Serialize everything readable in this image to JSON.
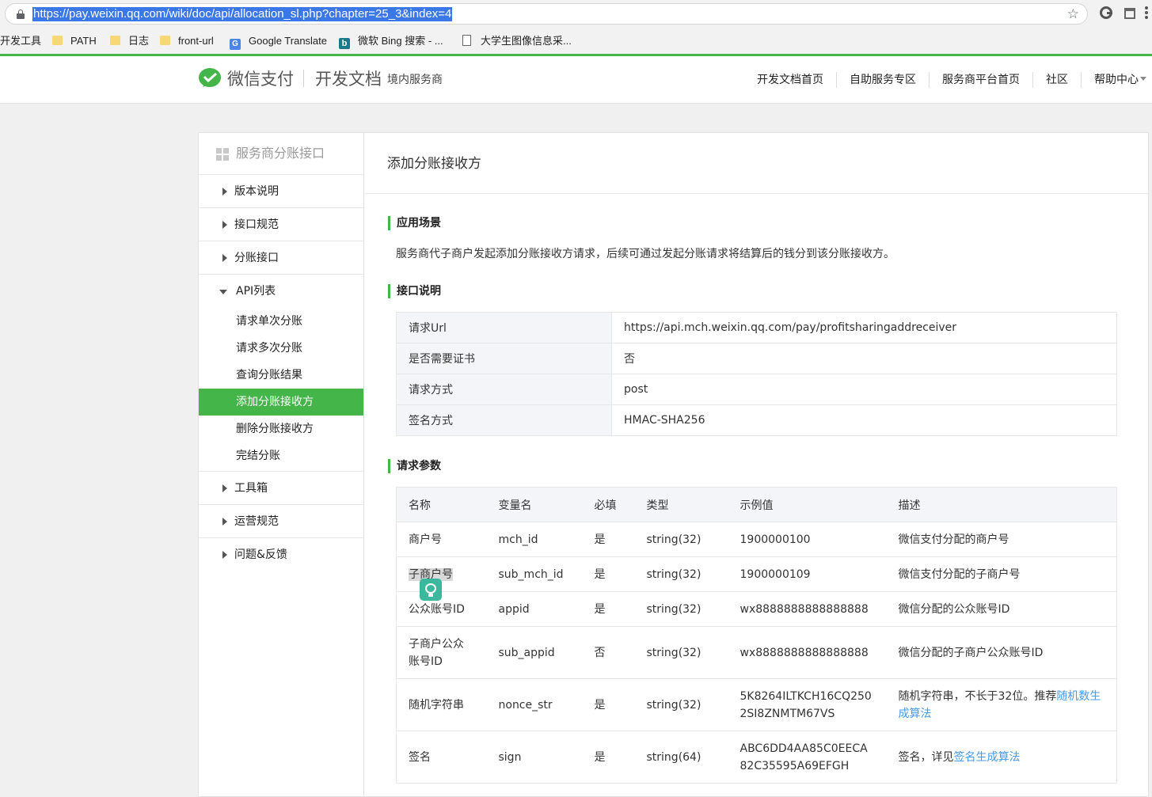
{
  "browser": {
    "url": "https://pay.weixin.qq.com/wiki/doc/api/allocation_sl.php?chapter=25_3&index=4",
    "bookmarks": [
      {
        "label": "开发工具",
        "icon": "none"
      },
      {
        "label": "PATH",
        "icon": "folder-icon"
      },
      {
        "label": "日志",
        "icon": "folder-icon"
      },
      {
        "label": "front-url",
        "icon": "folder-icon"
      },
      {
        "label": "Google Translate",
        "icon": "google-translate-icon"
      },
      {
        "label": "微软 Bing 搜索 - ...",
        "icon": "bing-icon"
      },
      {
        "label": "大学生图像信息采...",
        "icon": "page-icon"
      }
    ]
  },
  "header": {
    "logo_text": "微信支付",
    "doc_title": "开发文档",
    "doc_subtitle": "境内服务商",
    "nav": [
      "开发文档首页",
      "自助服务专区",
      "服务商平台首页",
      "社区",
      "帮助中心"
    ],
    "brand_color": "#44b549"
  },
  "sidebar": {
    "title": "服务商分账接口",
    "items": [
      "版本说明",
      "接口规范",
      "分账接口"
    ],
    "group": {
      "label": "API列表",
      "subitems": [
        "请求单次分账",
        "请求多次分账",
        "查询分账结果",
        "添加分账接收方",
        "删除分账接收方",
        "完结分账"
      ],
      "active": "添加分账接收方"
    },
    "items_after": [
      "工具箱",
      "运营规范",
      "问题&反馈"
    ]
  },
  "content": {
    "title": "添加分账接收方",
    "sections": {
      "scene": "应用场景",
      "interface": "接口说明",
      "params": "请求参数"
    },
    "scene_text": "服务商代子商户发起添加分账接收方请求，后续可通过发起分账请求将结算后的钱分到该分账接收方。",
    "info": [
      {
        "key": "请求Url",
        "value": "https://api.mch.weixin.qq.com/pay/profitsharingaddreceiver"
      },
      {
        "key": "是否需要证书",
        "value": "否"
      },
      {
        "key": "请求方式",
        "value": "post"
      },
      {
        "key": "签名方式",
        "value": "HMAC-SHA256"
      }
    ],
    "param_headers": [
      "名称",
      "变量名",
      "必填",
      "类型",
      "示例值",
      "描述"
    ],
    "params": [
      {
        "name": "商户号",
        "var": "mch_id",
        "req": "是",
        "type": "string(32)",
        "example": "1900000100",
        "desc": "微信支付分配的商户号",
        "link": ""
      },
      {
        "name": "子商户号",
        "var": "sub_mch_id",
        "req": "是",
        "type": "string(32)",
        "example": "1900000109",
        "desc": "微信支付分配的子商户号",
        "link": ""
      },
      {
        "name": "公众账号ID",
        "var": "appid",
        "req": "是",
        "type": "string(32)",
        "example": "wx8888888888888888",
        "desc": "微信分配的公众账号ID",
        "link": ""
      },
      {
        "name": "子商户公众账号ID",
        "var": "sub_appid",
        "req": "否",
        "type": "string(32)",
        "example": "wx8888888888888888",
        "desc": "微信分配的子商户公众账号ID",
        "link": ""
      },
      {
        "name": "随机字符串",
        "var": "nonce_str",
        "req": "是",
        "type": "string(32)",
        "example": "5K8264ILTKCH16CQ2502SI8ZNMTM67VS",
        "desc": "随机字符串，不长于32位。推荐",
        "link": "随机数生成算法"
      },
      {
        "name": "签名",
        "var": "sign",
        "req": "是",
        "type": "string(64)",
        "example": "ABC6DD4AA85C0EECA82C35595A69EFGH",
        "desc": "签名，详见",
        "link": "签名生成算法"
      }
    ]
  }
}
